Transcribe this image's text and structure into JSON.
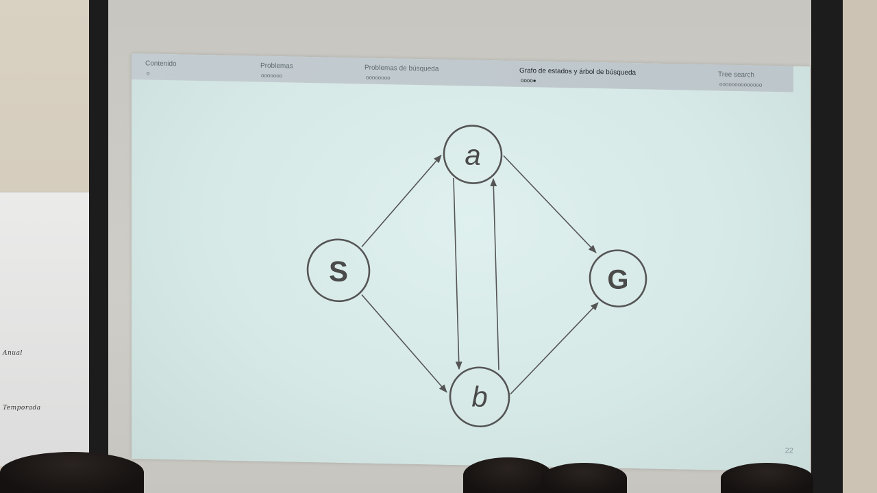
{
  "slide": {
    "nav": [
      {
        "label": "Contenido",
        "progress": "o",
        "active": false
      },
      {
        "label": "Problemas",
        "progress": "ooooooo",
        "active": false
      },
      {
        "label": "Problemas de búsqueda",
        "progress": "oooooooo",
        "active": false
      },
      {
        "label": "Grafo de estados y árbol de búsqueda",
        "progress": "oooo●",
        "active": true
      },
      {
        "label": "Tree search",
        "progress": "oooooooooooooo",
        "active": false
      }
    ],
    "page_number": "22"
  },
  "graph": {
    "nodes": [
      {
        "id": "S",
        "label": "S",
        "style": "bold"
      },
      {
        "id": "a",
        "label": "a",
        "style": "italic"
      },
      {
        "id": "b",
        "label": "b",
        "style": "italic"
      },
      {
        "id": "G",
        "label": "G",
        "style": "bold"
      }
    ],
    "edges": [
      {
        "from": "S",
        "to": "a"
      },
      {
        "from": "S",
        "to": "b"
      },
      {
        "from": "a",
        "to": "b"
      },
      {
        "from": "b",
        "to": "a"
      },
      {
        "from": "a",
        "to": "G"
      },
      {
        "from": "b",
        "to": "G"
      }
    ]
  },
  "poster": {
    "line1": "Anual",
    "line2": "Temporada"
  },
  "colors": {
    "slide_bg": "#dff0ee",
    "navbar": "#c3ccd0",
    "graph_stroke": "#555555"
  }
}
